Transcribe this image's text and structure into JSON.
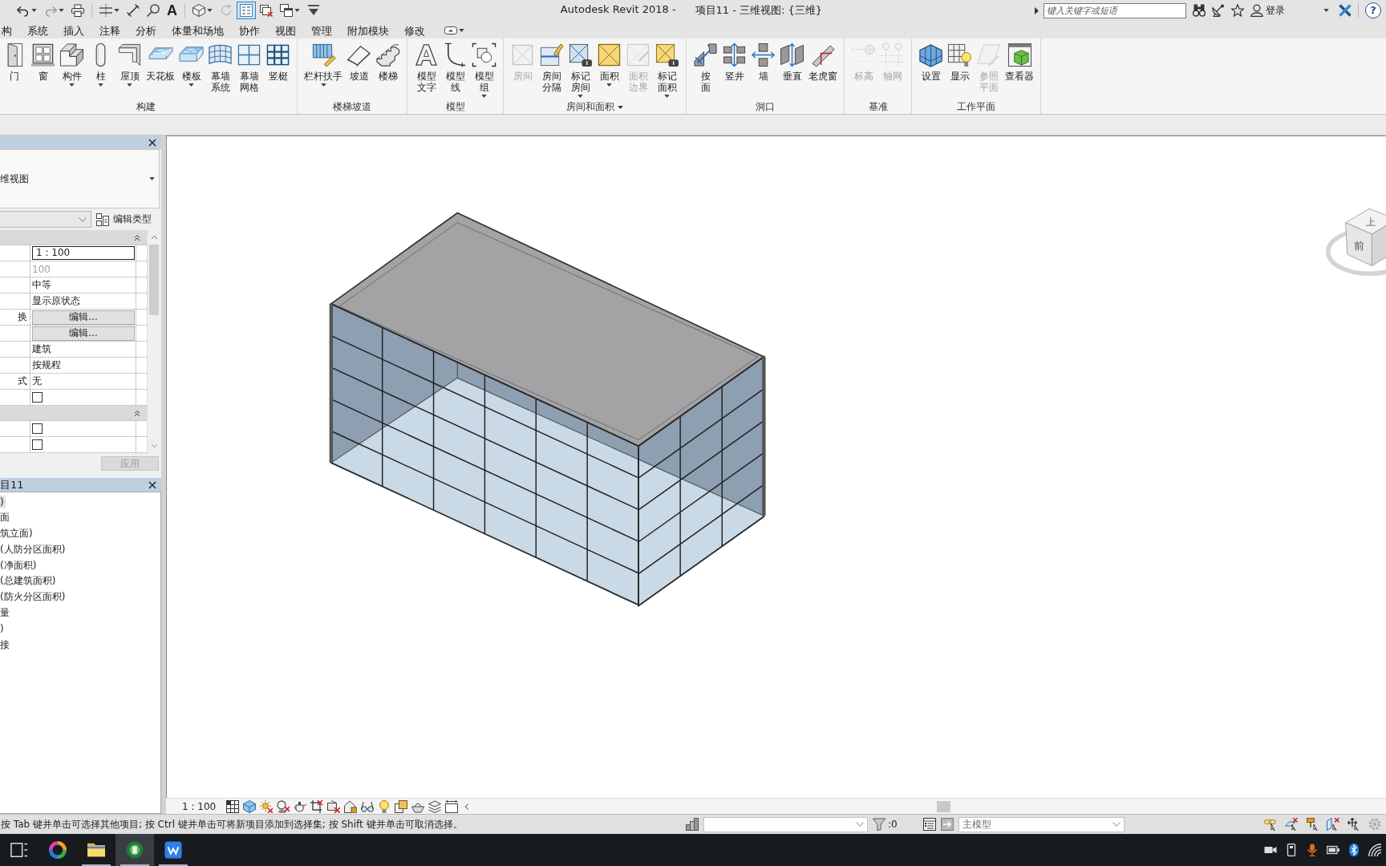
{
  "title_bar": {
    "app": "Autodesk Revit 2018 -",
    "document": "项目11 - 三维视图: {三维}",
    "search": {
      "placeholder": "键入关键字或短语"
    },
    "sign_in": "登录",
    "help": "?"
  },
  "quick_access": [
    {
      "dropdown": true,
      "on": false,
      "disabled": false
    },
    {
      "dropdown": true,
      "on": false,
      "disabled": true
    },
    {
      "dropdown": false,
      "on": false,
      "disabled": false
    },
    {
      "dropdown": true,
      "on": false,
      "disabled": false
    },
    {
      "dropdown": false,
      "on": false,
      "disabled": false
    },
    {
      "dropdown": false,
      "on": false,
      "disabled": false
    },
    {
      "glyph": "A",
      "dropdown": false,
      "on": false,
      "disabled": false
    },
    {
      "dropdown": true,
      "on": false,
      "disabled": false
    },
    {
      "dropdown": false,
      "on": false,
      "disabled": true
    },
    {
      "dropdown": false,
      "on": true,
      "disabled": false
    },
    {
      "dropdown": false,
      "on": false,
      "disabled": false
    },
    {
      "dropdown": true,
      "on": false,
      "disabled": false
    },
    {
      "dropdown": false,
      "on": false,
      "disabled": false
    }
  ],
  "ribbon_tabs": [
    {
      "label": "构",
      "selected": false
    },
    {
      "label": "系统",
      "selected": false
    },
    {
      "label": "插入",
      "selected": false
    },
    {
      "label": "注释",
      "selected": false
    },
    {
      "label": "分析",
      "selected": false
    },
    {
      "label": "体量和场地",
      "selected": false
    },
    {
      "label": "协作",
      "selected": false
    },
    {
      "label": "视图",
      "selected": false
    },
    {
      "label": "管理",
      "selected": false
    },
    {
      "label": "附加模块",
      "selected": false
    },
    {
      "label": "修改",
      "selected": false
    }
  ],
  "ribbon_panels": [
    {
      "label": "构建",
      "menu": false,
      "buttons": [
        {
          "label": "门",
          "dropdown": false,
          "disabled": false
        },
        {
          "label": "窗",
          "dropdown": false,
          "disabled": false
        },
        {
          "label": "构件",
          "dropdown": true,
          "disabled": false
        },
        {
          "label": "柱",
          "dropdown": true,
          "disabled": false
        },
        {
          "label": "屋顶",
          "dropdown": true,
          "disabled": false
        },
        {
          "label": "天花板",
          "dropdown": false,
          "disabled": false
        },
        {
          "label": "楼板",
          "dropdown": true,
          "disabled": false
        },
        {
          "label": "幕墙系统",
          "dropdown": false,
          "disabled": false
        },
        {
          "label": "幕墙网格",
          "dropdown": false,
          "disabled": false
        },
        {
          "label": "竖梃",
          "dropdown": false,
          "disabled": false
        }
      ]
    },
    {
      "label": "楼梯坡道",
      "menu": false,
      "buttons": [
        {
          "label": "栏杆扶手",
          "dropdown": true,
          "disabled": false
        },
        {
          "label": "坡道",
          "dropdown": false,
          "disabled": false
        },
        {
          "label": "楼梯",
          "dropdown": false,
          "disabled": false
        }
      ]
    },
    {
      "label": "模型",
      "menu": false,
      "buttons": [
        {
          "label": "模型文字",
          "dropdown": false,
          "disabled": false
        },
        {
          "label": "模型线",
          "dropdown": false,
          "disabled": false
        },
        {
          "label": "模型组",
          "dropdown": true,
          "disabled": false
        }
      ]
    },
    {
      "label": "房间和面积",
      "menu": true,
      "buttons": [
        {
          "label": "房间",
          "dropdown": false,
          "disabled": true
        },
        {
          "label": "房间分隔",
          "dropdown": false,
          "disabled": false
        },
        {
          "label": "标记房间",
          "dropdown": true,
          "disabled": false
        },
        {
          "label": "面积",
          "dropdown": true,
          "disabled": false
        },
        {
          "label": "面积边界",
          "dropdown": false,
          "disabled": true
        },
        {
          "label": "标记面积",
          "dropdown": true,
          "disabled": false
        }
      ]
    },
    {
      "label": "洞口",
      "menu": false,
      "buttons": [
        {
          "label": "按面",
          "dropdown": false,
          "disabled": false
        },
        {
          "label": "竖井",
          "dropdown": false,
          "disabled": false
        },
        {
          "label": "墙",
          "dropdown": false,
          "disabled": false
        },
        {
          "label": "垂直",
          "dropdown": false,
          "disabled": false
        },
        {
          "label": "老虎窗",
          "dropdown": false,
          "disabled": false
        }
      ]
    },
    {
      "label": "基准",
      "menu": false,
      "buttons": [
        {
          "label": "标高",
          "dropdown": false,
          "disabled": true
        },
        {
          "label": "轴网",
          "dropdown": false,
          "disabled": true
        }
      ]
    },
    {
      "label": "工作平面",
      "menu": false,
      "buttons": [
        {
          "label": "设置",
          "dropdown": false,
          "disabled": false
        },
        {
          "label": "显示",
          "dropdown": false,
          "disabled": false
        },
        {
          "label": "参照平面",
          "dropdown": false,
          "disabled": true
        },
        {
          "label": "查看器",
          "dropdown": false,
          "disabled": false
        }
      ]
    }
  ],
  "properties": {
    "type_name": "维视图",
    "edit_type": "编辑类型",
    "sections": [
      {
        "expanded": true,
        "rows": [
          {
            "kind": "input",
            "value": "1 : 100"
          },
          {
            "kind": "readonly",
            "value": "100"
          },
          {
            "kind": "text",
            "value": "中等"
          },
          {
            "kind": "text",
            "value": "显示原状态"
          },
          {
            "kind": "button",
            "label": "换",
            "value": "编辑..."
          },
          {
            "kind": "button",
            "value": "编辑..."
          },
          {
            "kind": "text",
            "value": "建筑"
          },
          {
            "kind": "text",
            "value": "按规程"
          },
          {
            "kind": "text",
            "label": "式",
            "value": "无"
          },
          {
            "kind": "checkbox",
            "checked": false
          }
        ]
      },
      {
        "expanded": true,
        "rows": [
          {
            "kind": "checkbox",
            "checked": false
          },
          {
            "kind": "checkbox",
            "checked": false
          }
        ]
      }
    ],
    "apply": {
      "label": "应用",
      "disabled": true
    }
  },
  "project_browser": {
    "title": "目11",
    "items": [
      {
        "label": ")",
        "selected": true
      },
      {
        "label": "面",
        "selected": false
      },
      {
        "label": "筑立面)",
        "selected": false
      },
      {
        "label": "(人防分区面积)",
        "selected": false
      },
      {
        "label": "(净面积)",
        "selected": false
      },
      {
        "label": "(总建筑面积)",
        "selected": false
      },
      {
        "label": "(防火分区面积)",
        "selected": false
      },
      {
        "label": "量",
        "selected": false
      },
      {
        "label": ")",
        "selected": false
      },
      {
        "label": "接",
        "selected": false
      }
    ]
  },
  "view": {
    "view_cube": {
      "top": "上",
      "front": "前"
    }
  },
  "view_control_bar": {
    "scale": "1 : 100"
  },
  "status_bar": {
    "hint": "按 Tab 键并单击可选择其他项目; 按 Ctrl 键并单击可将新项目添加到选择集; 按 Shift 键并单击可取消选择。",
    "selection_count": ":0",
    "model": "主模型"
  },
  "taskbar": {
    "apps": [
      {
        "running": false,
        "selected": false
      },
      {
        "running": true,
        "selected": false
      },
      {
        "running": true,
        "selected": true
      },
      {
        "running": true,
        "selected": false
      }
    ]
  }
}
